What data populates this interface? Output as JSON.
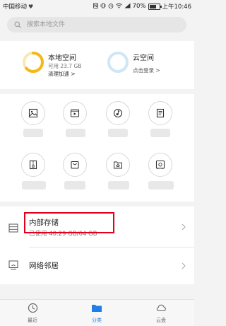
{
  "status_bar": {
    "carrier": "中国移动",
    "battery": "70%",
    "battery_level": 0.7,
    "time": "上午10:46"
  },
  "search": {
    "placeholder": "搜索本地文件"
  },
  "storage": {
    "local": {
      "title": "本地空间",
      "available": "可用 23.7 GB",
      "action": "清理加速 >",
      "ring_color": "#f5b719",
      "used_fraction": 0.63
    },
    "cloud": {
      "title": "云空间",
      "action": "点击登录 >",
      "ring_color": "#cfe6f7"
    }
  },
  "categories": [
    {
      "icon": "image-icon"
    },
    {
      "icon": "video-icon"
    },
    {
      "icon": "music-icon"
    },
    {
      "icon": "document-icon"
    },
    {
      "icon": "archive-icon"
    },
    {
      "icon": "package-icon"
    },
    {
      "icon": "favorites-icon"
    },
    {
      "icon": "safe-icon"
    }
  ],
  "list": {
    "internal_storage": {
      "title": "内部存储",
      "subtitle": "已使用 40.29 GB/64 GB"
    },
    "network": {
      "title": "网络邻居"
    }
  },
  "bottom_nav": {
    "items": [
      {
        "label": "最近",
        "icon": "clock-icon",
        "active": false
      },
      {
        "label": "分类",
        "icon": "folder-icon",
        "active": true
      },
      {
        "label": "云盘",
        "icon": "cloud-icon",
        "active": false
      }
    ],
    "active_color": "#1f7fe6"
  }
}
